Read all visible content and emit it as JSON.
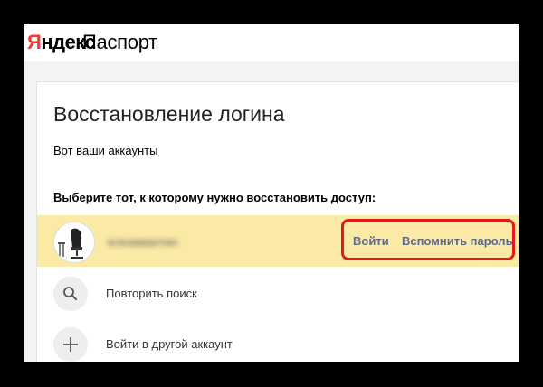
{
  "header": {
    "brand": "Яндекс",
    "service": "Паспорт"
  },
  "page": {
    "title": "Восстановление логина",
    "subtitle": "Вот ваши аккаунты",
    "instruction": "Выберите тот, к которому нужно восстановить доступ:"
  },
  "account": {
    "name": "ксенимахтин",
    "login_label": "Войти",
    "remember_password_label": "Вспомнить пароль",
    "row_color": "#fbeaa5",
    "highlight_color": "#e11a1a"
  },
  "options": {
    "repeat_search_label": "Повторить поиск",
    "repeat_search_icon": "search-icon",
    "other_account_label": "Войти в другой аккаунт",
    "other_account_icon": "plus-icon"
  }
}
